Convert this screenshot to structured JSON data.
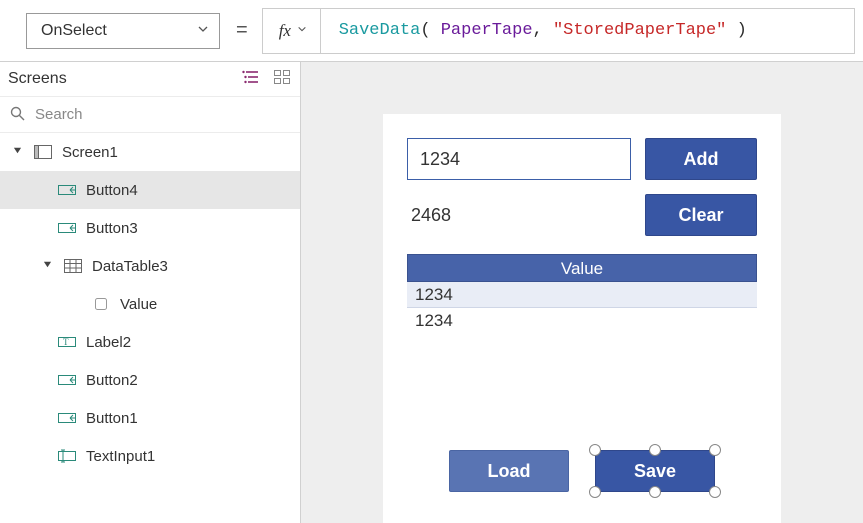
{
  "topbar": {
    "property": "OnSelect",
    "eq": "=",
    "fx_label": "fx",
    "formula_fn": "SaveData",
    "formula_open": "( ",
    "formula_ident": "PaperTape",
    "formula_comma": ", ",
    "formula_str": "\"StoredPaperTape\"",
    "formula_close": " )"
  },
  "sidebar": {
    "title": "Screens",
    "search_placeholder": "Search",
    "tree": {
      "screen1": "Screen1",
      "button4": "Button4",
      "button3": "Button3",
      "datatable3": "DataTable3",
      "value": "Value",
      "label2": "Label2",
      "button2": "Button2",
      "button1": "Button1",
      "textinput1": "TextInput1"
    }
  },
  "canvas": {
    "input_value": "1234",
    "result_value": "2468",
    "add_label": "Add",
    "clear_label": "Clear",
    "table_header": "Value",
    "table_rows": [
      "1234",
      "1234"
    ],
    "row0": "1234",
    "row1": "1234",
    "load_label": "Load",
    "save_label": "Save"
  },
  "colors": {
    "accent": "#3856a4",
    "accent_light": "#5974b3",
    "selection_bg": "#e6e6e6"
  }
}
